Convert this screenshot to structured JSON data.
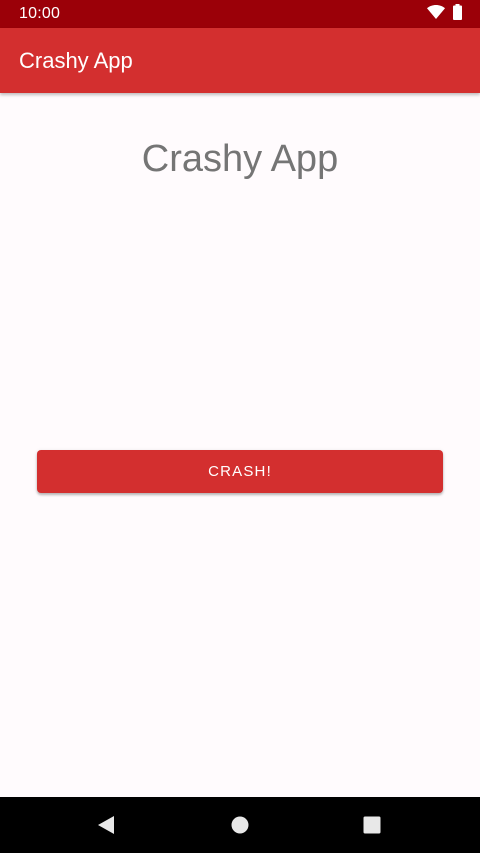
{
  "status_bar": {
    "time": "10:00",
    "icons": [
      "wifi-icon",
      "battery-icon"
    ]
  },
  "app_bar": {
    "title": "Crashy App"
  },
  "main": {
    "headline": "Crashy App",
    "crash_button_label": "CRASH!"
  },
  "nav_bar": {
    "icons": [
      "back-icon",
      "home-icon",
      "recents-icon"
    ]
  },
  "colors": {
    "status_bar": "#9b0008",
    "primary": "#d32f2f",
    "background": "#fffbfd",
    "headline_text": "#757575",
    "nav_bar": "#000000"
  }
}
